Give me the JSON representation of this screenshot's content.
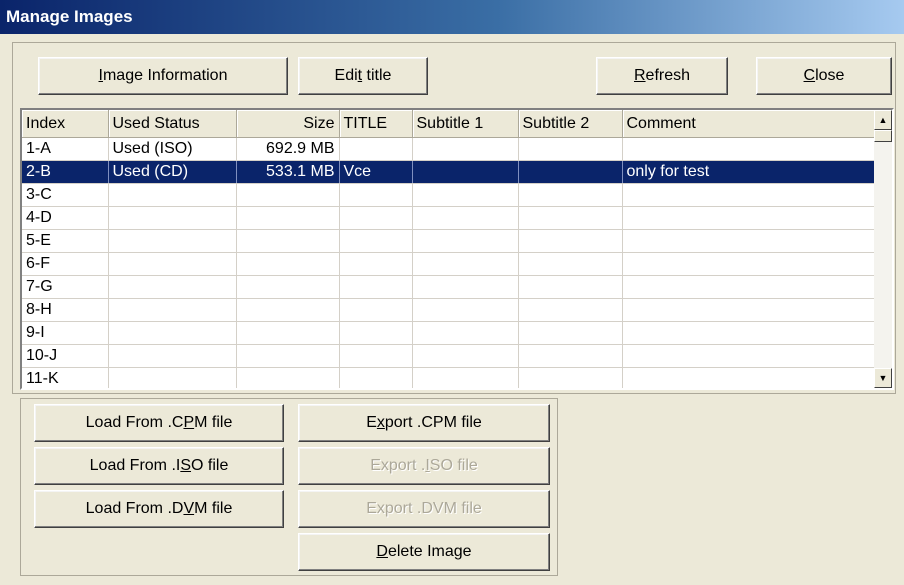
{
  "window": {
    "title": "Manage Images"
  },
  "toolbar": {
    "image_info_label": "Image Information",
    "image_info_key": "I",
    "edit_title_label": "Edit title",
    "edit_title_key": "t",
    "refresh_label": "Refresh",
    "refresh_key": "R",
    "close_label": "Close",
    "close_key": "C"
  },
  "table": {
    "columns": [
      "Index",
      "Used Status",
      "Size",
      "TITLE",
      "Subtitle 1",
      "Subtitle 2",
      "Comment"
    ],
    "rows": [
      {
        "index": "1-A",
        "status": "Used (ISO)",
        "size": "692.9 MB",
        "title": "",
        "sub1": "",
        "sub2": "",
        "comment": ""
      },
      {
        "index": "2-B",
        "status": "Used (CD)",
        "size": "533.1 MB",
        "title": "Vce",
        "sub1": "",
        "sub2": "",
        "comment": "only for test",
        "selected": true
      },
      {
        "index": "3-C",
        "status": "",
        "size": "",
        "title": "",
        "sub1": "",
        "sub2": "",
        "comment": ""
      },
      {
        "index": "4-D",
        "status": "",
        "size": "",
        "title": "",
        "sub1": "",
        "sub2": "",
        "comment": ""
      },
      {
        "index": "5-E",
        "status": "",
        "size": "",
        "title": "",
        "sub1": "",
        "sub2": "",
        "comment": ""
      },
      {
        "index": "6-F",
        "status": "",
        "size": "",
        "title": "",
        "sub1": "",
        "sub2": "",
        "comment": ""
      },
      {
        "index": "7-G",
        "status": "",
        "size": "",
        "title": "",
        "sub1": "",
        "sub2": "",
        "comment": ""
      },
      {
        "index": "8-H",
        "status": "",
        "size": "",
        "title": "",
        "sub1": "",
        "sub2": "",
        "comment": ""
      },
      {
        "index": "9-I",
        "status": "",
        "size": "",
        "title": "",
        "sub1": "",
        "sub2": "",
        "comment": ""
      },
      {
        "index": "10-J",
        "status": "",
        "size": "",
        "title": "",
        "sub1": "",
        "sub2": "",
        "comment": ""
      },
      {
        "index": "11-K",
        "status": "",
        "size": "",
        "title": "",
        "sub1": "",
        "sub2": "",
        "comment": ""
      }
    ]
  },
  "scrollbar": {
    "up_icon": "triangle-up-icon",
    "down_icon": "triangle-down-icon"
  },
  "actions": {
    "load_cpm_label": "Load From .CPM file",
    "load_cpm_key": "P",
    "load_iso_label": "Load From .ISO file",
    "load_iso_key": "S",
    "load_dvm_label": "Load From .DVM file",
    "load_dvm_key": "V",
    "export_cpm_label": "Export .CPM file",
    "export_cpm_key": "x",
    "export_iso_label": "Export .ISO file",
    "export_iso_key": "I",
    "export_dvm_label": "Export .DVM file",
    "export_dvm_key": "",
    "delete_label": "Delete Image",
    "delete_key": "D"
  },
  "colors": {
    "titlebar_start": "#0a246a",
    "selection": "#0a246a",
    "face": "#ece9d8",
    "disabled_text": "#aca899"
  }
}
